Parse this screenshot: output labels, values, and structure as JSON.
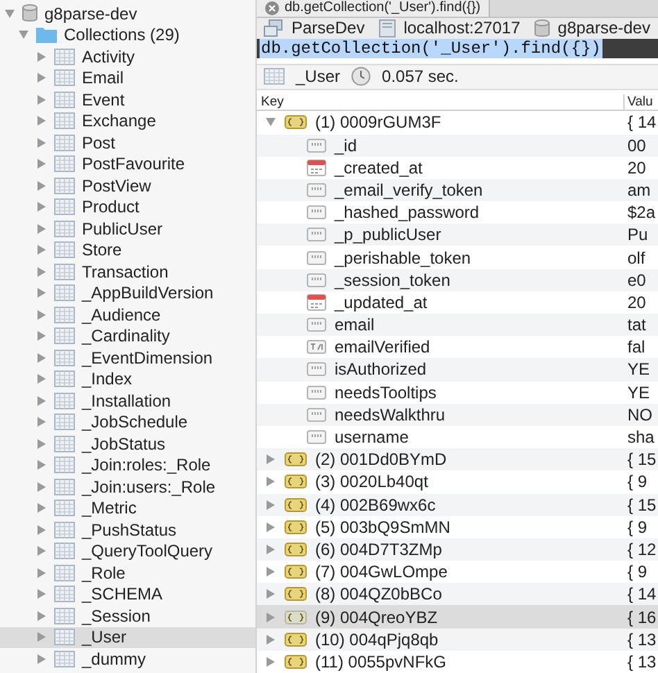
{
  "sidebar": {
    "database": {
      "label": "g8parse-dev",
      "expanded": true
    },
    "collections": {
      "label": "Collections (29)",
      "expanded": true,
      "items": [
        {
          "label": "Activity",
          "selected": false
        },
        {
          "label": "Email",
          "selected": false
        },
        {
          "label": "Event",
          "selected": false
        },
        {
          "label": "Exchange",
          "selected": false
        },
        {
          "label": "Post",
          "selected": false
        },
        {
          "label": "PostFavourite",
          "selected": false
        },
        {
          "label": "PostView",
          "selected": false
        },
        {
          "label": "Product",
          "selected": false
        },
        {
          "label": "PublicUser",
          "selected": false
        },
        {
          "label": "Store",
          "selected": false
        },
        {
          "label": "Transaction",
          "selected": false
        },
        {
          "label": "_AppBuildVersion",
          "selected": false
        },
        {
          "label": "_Audience",
          "selected": false
        },
        {
          "label": "_Cardinality",
          "selected": false
        },
        {
          "label": "_EventDimension",
          "selected": false
        },
        {
          "label": "_Index",
          "selected": false
        },
        {
          "label": "_Installation",
          "selected": false
        },
        {
          "label": "_JobSchedule",
          "selected": false
        },
        {
          "label": "_JobStatus",
          "selected": false
        },
        {
          "label": "_Join:roles:_Role",
          "selected": false
        },
        {
          "label": "_Join:users:_Role",
          "selected": false
        },
        {
          "label": "_Metric",
          "selected": false
        },
        {
          "label": "_PushStatus",
          "selected": false
        },
        {
          "label": "_QueryToolQuery",
          "selected": false
        },
        {
          "label": "_Role",
          "selected": false
        },
        {
          "label": "_SCHEMA",
          "selected": false
        },
        {
          "label": "_Session",
          "selected": false
        },
        {
          "label": "_User",
          "selected": true
        },
        {
          "label": "_dummy",
          "selected": false
        }
      ]
    }
  },
  "query_tab": {
    "label": "db.getCollection('_User').find({})"
  },
  "breadcrumb": [
    {
      "label": "ParseDev",
      "kind": "connection"
    },
    {
      "label": "localhost:27017",
      "kind": "server"
    },
    {
      "label": "g8parse-dev",
      "kind": "database"
    }
  ],
  "query": "db.getCollection('_User').find({})",
  "result_bar": {
    "collection": "_User",
    "time": "0.057 sec."
  },
  "table": {
    "columns": [
      "Key",
      "Valu"
    ],
    "rows": [
      {
        "key": "(1) 0009rGUM3F",
        "value": "{ 14",
        "expanded": true,
        "selected": false,
        "children": [
          {
            "key": "_id",
            "value": "00",
            "kind": "string"
          },
          {
            "key": "_created_at",
            "value": "20",
            "kind": "date"
          },
          {
            "key": "_email_verify_token",
            "value": "am",
            "kind": "string"
          },
          {
            "key": "_hashed_password",
            "value": "$2a",
            "kind": "string"
          },
          {
            "key": "_p_publicUser",
            "value": "Pu",
            "kind": "string"
          },
          {
            "key": "_perishable_token",
            "value": "olf",
            "kind": "string"
          },
          {
            "key": "_session_token",
            "value": "e0",
            "kind": "string"
          },
          {
            "key": "_updated_at",
            "value": "20",
            "kind": "date"
          },
          {
            "key": "email",
            "value": "tat",
            "kind": "string"
          },
          {
            "key": "emailVerified",
            "value": "fal",
            "kind": "boolean"
          },
          {
            "key": "isAuthorized",
            "value": "YE",
            "kind": "string"
          },
          {
            "key": "needsTooltips",
            "value": "YE",
            "kind": "string"
          },
          {
            "key": "needsWalkthru",
            "value": "NO",
            "kind": "string"
          },
          {
            "key": "username",
            "value": "sha",
            "kind": "string"
          }
        ]
      },
      {
        "key": "(2) 001Dd0BYmD",
        "value": "{ 15",
        "expanded": false,
        "selected": false
      },
      {
        "key": "(3) 0020Lb40qt",
        "value": "{ 9",
        "expanded": false,
        "selected": false
      },
      {
        "key": "(4) 002B69wx6c",
        "value": "{ 15",
        "expanded": false,
        "selected": false
      },
      {
        "key": "(5) 003bQ9SmMN",
        "value": "{ 9",
        "expanded": false,
        "selected": false
      },
      {
        "key": "(6) 004D7T3ZMp",
        "value": "{ 12",
        "expanded": false,
        "selected": false
      },
      {
        "key": "(7) 004GwLOmpe",
        "value": "{ 9",
        "expanded": false,
        "selected": false
      },
      {
        "key": "(8) 004QZ0bBCo",
        "value": "{ 14",
        "expanded": false,
        "selected": false
      },
      {
        "key": "(9) 004QreoYBZ",
        "value": "{ 16",
        "expanded": false,
        "selected": true
      },
      {
        "key": "(10) 004qPjq8qb",
        "value": "{ 13",
        "expanded": false,
        "selected": false
      },
      {
        "key": "(11) 0055pvNFkG",
        "value": "{ 13",
        "expanded": false,
        "selected": false
      }
    ]
  }
}
